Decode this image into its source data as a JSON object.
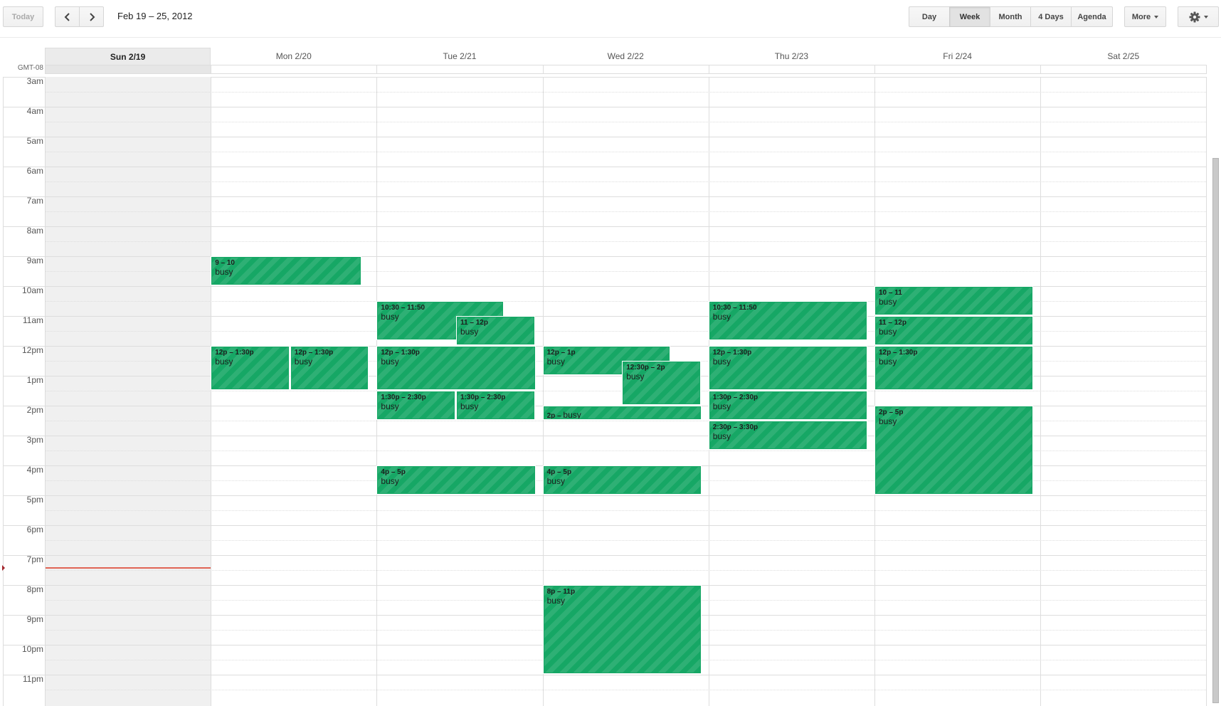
{
  "toolbar": {
    "today_label": "Today",
    "prev_icon": "chevron-left-icon",
    "next_icon": "chevron-right-icon",
    "date_range": "Feb 19 – 25, 2012",
    "views": [
      {
        "label": "Day",
        "active": false
      },
      {
        "label": "Week",
        "active": true
      },
      {
        "label": "Month",
        "active": false
      },
      {
        "label": "4 Days",
        "active": false
      },
      {
        "label": "Agenda",
        "active": false
      }
    ],
    "more_label": "More",
    "settings_icon": "gear-icon"
  },
  "timezone": "GMT-08",
  "days": [
    {
      "label": "Sun 2/19",
      "today": true
    },
    {
      "label": "Mon 2/20",
      "today": false
    },
    {
      "label": "Tue 2/21",
      "today": false
    },
    {
      "label": "Wed 2/22",
      "today": false
    },
    {
      "label": "Thu 2/23",
      "today": false
    },
    {
      "label": "Fri 2/24",
      "today": false
    },
    {
      "label": "Sat 2/25",
      "today": false
    }
  ],
  "hours": [
    "3am",
    "4am",
    "5am",
    "6am",
    "7am",
    "8am",
    "9am",
    "10am",
    "11am",
    "12pm",
    "1pm",
    "2pm",
    "3pm",
    "4pm",
    "5pm",
    "6pm",
    "7pm",
    "8pm",
    "9pm",
    "10pm",
    "11pm"
  ],
  "grid_start_hour": 3,
  "current_time_hour": 19.4,
  "event_color": "#16a765",
  "now_line_color": "#dd4b39",
  "events": [
    {
      "day": 1,
      "start": 9,
      "end": 10,
      "time": "9 – 10",
      "title": "busy",
      "col": 0,
      "cols": 1,
      "w": 0.95
    },
    {
      "day": 1,
      "start": 12,
      "end": 13.5,
      "time": "12p – 1:30p",
      "title": "busy",
      "col": 0,
      "cols": 2
    },
    {
      "day": 1,
      "start": 12,
      "end": 13.5,
      "time": "12p – 1:30p",
      "title": "busy",
      "col": 1,
      "cols": 2
    },
    {
      "day": 2,
      "start": 10.5,
      "end": 11.8333,
      "time": "10:30 – 11:50",
      "title": "busy",
      "col": 0,
      "cols": 1,
      "w": 0.8
    },
    {
      "day": 2,
      "start": 11,
      "end": 12,
      "time": "11 – 12p",
      "title": "busy",
      "col": 1,
      "cols": 2
    },
    {
      "day": 2,
      "start": 12,
      "end": 13.5,
      "time": "12p – 1:30p",
      "title": "busy",
      "col": 0,
      "cols": 1
    },
    {
      "day": 2,
      "start": 13.5,
      "end": 14.5,
      "time": "1:30p – 2:30p",
      "title": "busy",
      "col": 0,
      "cols": 2
    },
    {
      "day": 2,
      "start": 13.5,
      "end": 14.5,
      "time": "1:30p – 2:30p",
      "title": "busy",
      "col": 1,
      "cols": 2
    },
    {
      "day": 2,
      "start": 16,
      "end": 17,
      "time": "4p – 5p",
      "title": "busy",
      "col": 0,
      "cols": 1
    },
    {
      "day": 3,
      "start": 12,
      "end": 13,
      "time": "12p – 1p",
      "title": "busy",
      "col": 0,
      "cols": 1,
      "w": 0.8
    },
    {
      "day": 3,
      "start": 12.5,
      "end": 14,
      "time": "12:30p – 2p",
      "title": "busy",
      "col": 1,
      "cols": 2
    },
    {
      "day": 3,
      "start": 14,
      "end": 14.5,
      "time": "2p – ",
      "title": "busy",
      "col": 0,
      "cols": 1,
      "inline": true
    },
    {
      "day": 3,
      "start": 16,
      "end": 17,
      "time": "4p – 5p",
      "title": "busy",
      "col": 0,
      "cols": 1
    },
    {
      "day": 3,
      "start": 20,
      "end": 23,
      "time": "8p – 11p",
      "title": "busy",
      "col": 0,
      "cols": 1
    },
    {
      "day": 4,
      "start": 10.5,
      "end": 11.8333,
      "time": "10:30 – 11:50",
      "title": "busy",
      "col": 0,
      "cols": 1
    },
    {
      "day": 4,
      "start": 12,
      "end": 13.5,
      "time": "12p – 1:30p",
      "title": "busy",
      "col": 0,
      "cols": 1
    },
    {
      "day": 4,
      "start": 13.5,
      "end": 14.5,
      "time": "1:30p – 2:30p",
      "title": "busy",
      "col": 0,
      "cols": 1
    },
    {
      "day": 4,
      "start": 14.5,
      "end": 15.5,
      "time": "2:30p – 3:30p",
      "title": "busy",
      "col": 0,
      "cols": 1
    },
    {
      "day": 5,
      "start": 10,
      "end": 11,
      "time": "10 – 11",
      "title": "busy",
      "col": 0,
      "cols": 1
    },
    {
      "day": 5,
      "start": 11,
      "end": 12,
      "time": "11 – 12p",
      "title": "busy",
      "col": 0,
      "cols": 1
    },
    {
      "day": 5,
      "start": 12,
      "end": 13.5,
      "time": "12p – 1:30p",
      "title": "busy",
      "col": 0,
      "cols": 1
    },
    {
      "day": 5,
      "start": 14,
      "end": 17,
      "time": "2p – 5p",
      "title": "busy",
      "col": 0,
      "cols": 1
    }
  ]
}
